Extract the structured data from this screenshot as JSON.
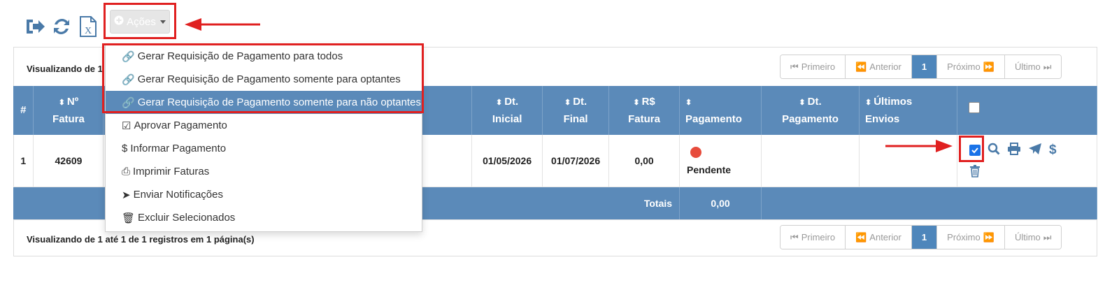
{
  "toolbar": {
    "icons": [
      "sign-out-icon",
      "refresh-icon",
      "excel-icon"
    ],
    "actions_label": "Ações"
  },
  "pagination": {
    "summary_top": "Visualizando de 1",
    "summary_bottom": "Visualizando de 1 até 1 de 1 registros em 1 página(s)",
    "first": "Primeiro",
    "previous": "Anterior",
    "current": "1",
    "next": "Próximo",
    "last": "Último"
  },
  "menu": {
    "items": [
      {
        "label": "Gerar Requisição de Pagamento para todos",
        "icon": "link-icon"
      },
      {
        "label": "Gerar Requisição de Pagamento somente para optantes",
        "icon": "link-icon"
      },
      {
        "label": "Gerar Requisição de Pagamento somente para não optantes",
        "icon": "link-icon"
      },
      {
        "label": "Aprovar Pagamento",
        "icon": "check-square-icon"
      },
      {
        "label": "Informar Pagamento",
        "icon": "dollar-icon"
      },
      {
        "label": "Imprimir Faturas",
        "icon": "print-icon"
      },
      {
        "label": "Enviar Notificações",
        "icon": "paper-plane-icon"
      },
      {
        "label": "Excluir Selecionados",
        "icon": "trash-icon"
      }
    ]
  },
  "table": {
    "headers": {
      "num": "#",
      "fatura_l1": "Nº",
      "fatura_l2": "Fatura",
      "dt_inicial_l1": "Dt.",
      "dt_inicial_l2": "Inicial",
      "dt_final_l1": "Dt.",
      "dt_final_l2": "Final",
      "valor_l1": "R$",
      "valor_l2": "Fatura",
      "pagamento": "Pagamento",
      "dt_pagamento_l1": "Dt.",
      "dt_pagamento_l2": "Pagamento",
      "envios_l1": "Últimos",
      "envios_l2": "Envios"
    },
    "row": {
      "index": "1",
      "fatura": "42609",
      "dt_inicial": "01/05/2026",
      "dt_final": "01/07/2026",
      "valor": "0,00",
      "pagamento_status": "Pendente",
      "status_color": "#e74c3c",
      "dt_pagamento": "",
      "ultimos_envios": "",
      "selected": true
    },
    "totals": {
      "label": "Totais",
      "value": "0,00"
    }
  },
  "colors": {
    "header_blue": "#5b8ab9",
    "highlight_red": "#e02020",
    "icon_blue": "#4a7aa8"
  }
}
